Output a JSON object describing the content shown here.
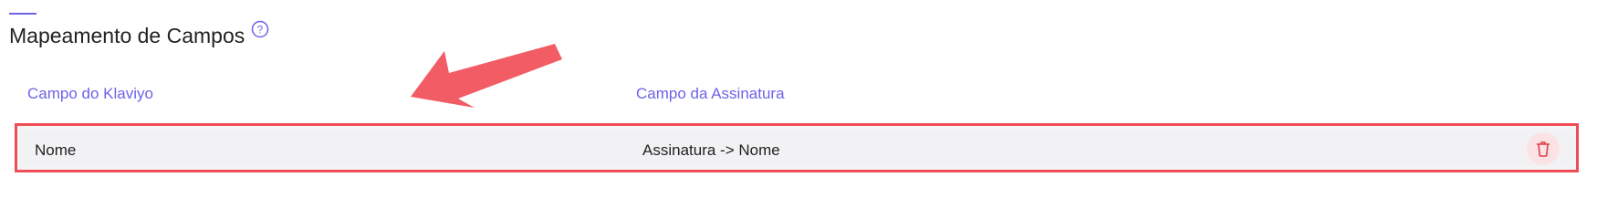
{
  "section": {
    "title": "Mapeamento de Campos",
    "help_icon": "question-circle-icon"
  },
  "columns": {
    "klaviyo": "Campo do Klaviyo",
    "assinatura": "Campo da Assinatura"
  },
  "rows": [
    {
      "klaviyo": "Nome",
      "assinatura": "Assinatura -> Nome",
      "action_icon": "trash-icon"
    }
  ],
  "colors": {
    "accent": "#6c63e8",
    "highlight": "#f04e56",
    "annotation_arrow": "#f25c64"
  }
}
